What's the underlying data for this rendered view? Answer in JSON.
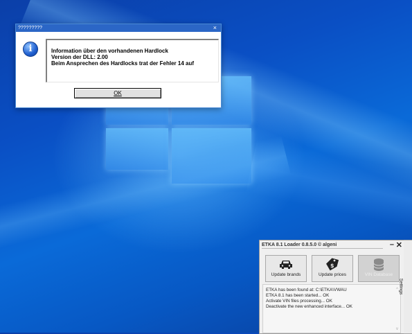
{
  "dialog": {
    "title": "?????????",
    "close_glyph": "×",
    "icon": "info-icon",
    "message_lines": [
      "Information über den vorhandenen Hardlock",
      "Version der DLL: 2.00",
      "Beim Ansprechen des Hardlocks trat der Fehler 14 auf"
    ],
    "ok_label": "OK"
  },
  "loader": {
    "title": "ETKA 8.1 Loader 0.8.5.0 © algeni",
    "minimize_glyph": "–",
    "close_glyph": "✕",
    "buttons": [
      {
        "label": "Update brands",
        "icon": "car-icon",
        "enabled": true
      },
      {
        "label": "Update prices",
        "icon": "price-tag-icon",
        "enabled": true
      },
      {
        "label": "VIN Database",
        "icon": "database-icon",
        "enabled": false
      }
    ],
    "log_lines": [
      "ETKA has been found at: C:\\ETKA\\VWAU",
      "ETKA 8.1 has been started... OK",
      "Activate VIN files processing... OK",
      "Deactivate the new enhanced interface... OK"
    ],
    "settings_tab": "Settings"
  },
  "colors": {
    "titlebar": "#2b66c6",
    "desktop": "#0a6ad8"
  }
}
